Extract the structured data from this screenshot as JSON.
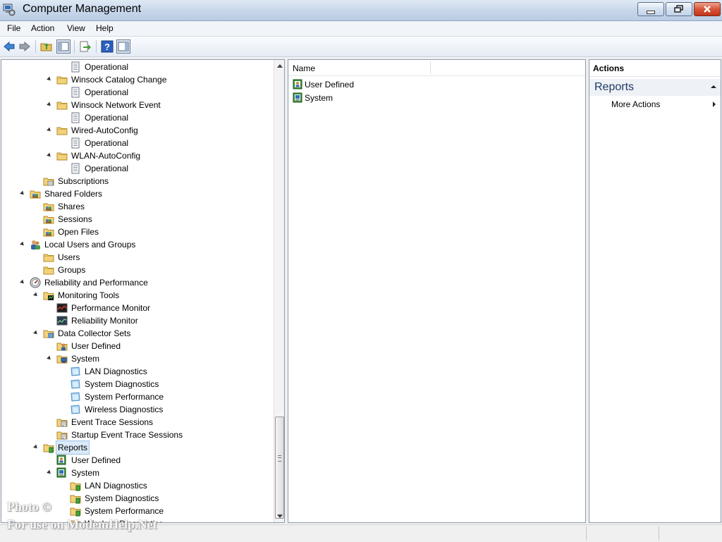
{
  "window": {
    "title": "Computer Management"
  },
  "menu": [
    "File",
    "Action",
    "View",
    "Help"
  ],
  "toolbar": {
    "icons": [
      "back-arrow-icon",
      "forward-arrow-icon",
      "up-folder-icon",
      "show-hide-tree-icon",
      "export-list-icon",
      "help-icon",
      "show-hide-action-pane-icon"
    ]
  },
  "tree": {
    "items": [
      {
        "label": "Operational",
        "icon": "log-icon"
      },
      {
        "label": "Winsock Catalog Change",
        "icon": "folder-icon",
        "expanded": true
      },
      {
        "label": "Operational",
        "icon": "log-icon"
      },
      {
        "label": "Winsock Network Event",
        "icon": "folder-icon",
        "expanded": true
      },
      {
        "label": "Operational",
        "icon": "log-icon"
      },
      {
        "label": "Wired-AutoConfig",
        "icon": "folder-icon",
        "expanded": true
      },
      {
        "label": "Operational",
        "icon": "log-icon"
      },
      {
        "label": "WLAN-AutoConfig",
        "icon": "folder-icon",
        "expanded": true
      },
      {
        "label": "Operational",
        "icon": "log-icon"
      },
      {
        "label": "Subscriptions",
        "icon": "subscriptions-icon"
      },
      {
        "label": "Shared Folders",
        "icon": "shared-folder-icon",
        "expanded": true
      },
      {
        "label": "Shares",
        "icon": "shared-folder-icon"
      },
      {
        "label": "Sessions",
        "icon": "shared-folder-icon"
      },
      {
        "label": "Open Files",
        "icon": "shared-folder-icon"
      },
      {
        "label": "Local Users and Groups",
        "icon": "users-groups-icon",
        "expanded": true
      },
      {
        "label": "Users",
        "icon": "folder-icon"
      },
      {
        "label": "Groups",
        "icon": "folder-icon"
      },
      {
        "label": "Reliability and Performance",
        "icon": "gauge-icon",
        "expanded": true
      },
      {
        "label": "Monitoring Tools",
        "icon": "monitoring-folder-icon",
        "expanded": true
      },
      {
        "label": "Performance Monitor",
        "icon": "performance-monitor-icon"
      },
      {
        "label": "Reliability Monitor",
        "icon": "reliability-monitor-icon"
      },
      {
        "label": "Data Collector Sets",
        "icon": "collector-folder-icon",
        "expanded": true
      },
      {
        "label": "User Defined",
        "icon": "user-defined-icon"
      },
      {
        "label": "System",
        "icon": "system-set-icon",
        "expanded": true
      },
      {
        "label": "LAN Diagnostics",
        "icon": "collector-set-icon"
      },
      {
        "label": "System Diagnostics",
        "icon": "collector-set-icon"
      },
      {
        "label": "System Performance",
        "icon": "collector-set-icon"
      },
      {
        "label": "Wireless Diagnostics",
        "icon": "collector-set-icon"
      },
      {
        "label": "Event Trace Sessions",
        "icon": "trace-folder-icon"
      },
      {
        "label": "Startup Event Trace Sessions",
        "icon": "trace-folder-icon"
      },
      {
        "label": "Reports",
        "icon": "reports-folder-icon",
        "expanded": true,
        "selected": true
      },
      {
        "label": "User Defined",
        "icon": "report-user-defined-icon"
      },
      {
        "label": "System",
        "icon": "report-system-icon",
        "expanded": true
      },
      {
        "label": "LAN Diagnostics",
        "icon": "report-folder-icon"
      },
      {
        "label": "System Diagnostics",
        "icon": "report-folder-icon"
      },
      {
        "label": "System Performance",
        "icon": "report-folder-icon"
      },
      {
        "label": "Wireless Diagnostics",
        "icon": "report-folder-icon"
      }
    ]
  },
  "list": {
    "columns": [
      "Name"
    ],
    "rows": [
      {
        "name": "User Defined",
        "icon": "report-user-defined-icon"
      },
      {
        "name": "System",
        "icon": "report-system-icon"
      }
    ]
  },
  "actions": {
    "title": "Actions",
    "section": "Reports",
    "items": [
      "More Actions"
    ]
  },
  "watermark": {
    "line1": "Photo ©",
    "line2": "For use on ModemHelp.Net"
  }
}
